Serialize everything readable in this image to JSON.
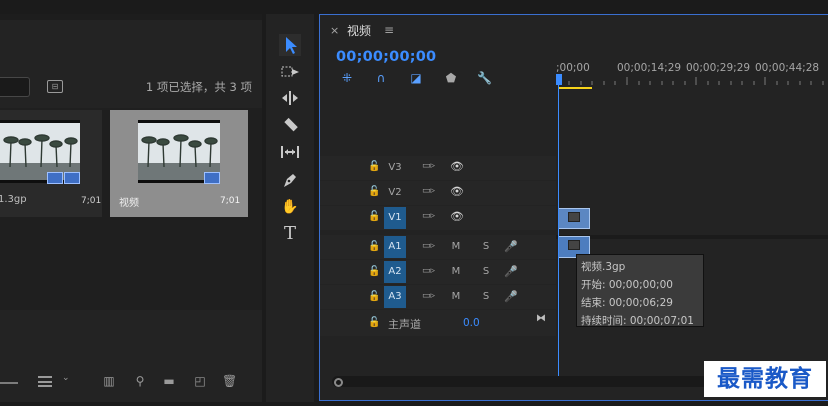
{
  "project": {
    "selection_info": "1 项已选择，共 3 项",
    "items": [
      {
        "name": "1.3gp",
        "duration": "7;01"
      },
      {
        "name": "视频",
        "duration": "7;01"
      }
    ]
  },
  "timeline": {
    "title": "视频",
    "close_label": "×",
    "menu_label": "≡",
    "timecode": "00;00;00;00",
    "ruler": [
      ";00;00",
      "00;00;14;29",
      "00;00;29;29",
      "00;00;44;28"
    ],
    "video_tracks": [
      "V3",
      "V2",
      "V1"
    ],
    "audio_tracks": [
      "A1",
      "A2",
      "A3"
    ],
    "mute_label": "M",
    "solo_label": "S",
    "master_label": "主声道",
    "master_value": "0.0",
    "tooltip": {
      "name": "视频.3gp",
      "start": "开始: 00;00;00;00",
      "end": "结束: 00;00;06;29",
      "duration": "持续时间: 00;00;07;01"
    }
  },
  "watermark": "最需教育",
  "colors": {
    "accent": "#3b8cff",
    "track_selected": "#1f5b8e",
    "workarea": "#f6d31b",
    "clip": "#5c87c2"
  }
}
